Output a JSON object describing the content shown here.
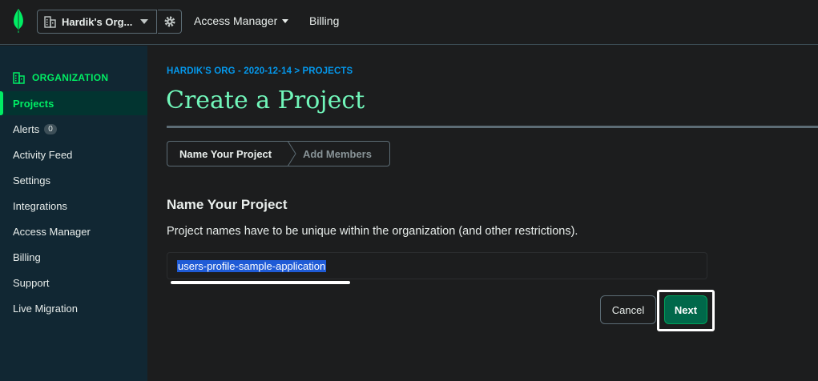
{
  "topbar": {
    "org_name": "Hardik's Org...",
    "access_manager_label": "Access Manager",
    "billing_label": "Billing"
  },
  "sidebar": {
    "heading": "ORGANIZATION",
    "items": [
      {
        "label": "Projects",
        "active": true
      },
      {
        "label": "Alerts",
        "count": "0"
      },
      {
        "label": "Activity Feed"
      },
      {
        "label": "Settings"
      },
      {
        "label": "Integrations"
      },
      {
        "label": "Access Manager"
      },
      {
        "label": "Billing"
      },
      {
        "label": "Support"
      },
      {
        "label": "Live Migration"
      }
    ]
  },
  "main": {
    "breadcrumb": "HARDIK'S ORG - 2020-12-14 > PROJECTS",
    "title": "Create a Project",
    "steps": [
      "Name Your Project",
      "Add Members"
    ],
    "section_title": "Name Your Project",
    "helper_text": "Project names have to be unique within the organization (and other restrictions).",
    "project_name_value": "users-profile-sample-application",
    "cancel_label": "Cancel",
    "next_label": "Next"
  },
  "colors": {
    "brand_green": "#00ed64",
    "title_green": "#71f6ba",
    "link_blue": "#0498ec",
    "selection_blue": "#1f5bd6",
    "primary_button": "#00684a"
  }
}
